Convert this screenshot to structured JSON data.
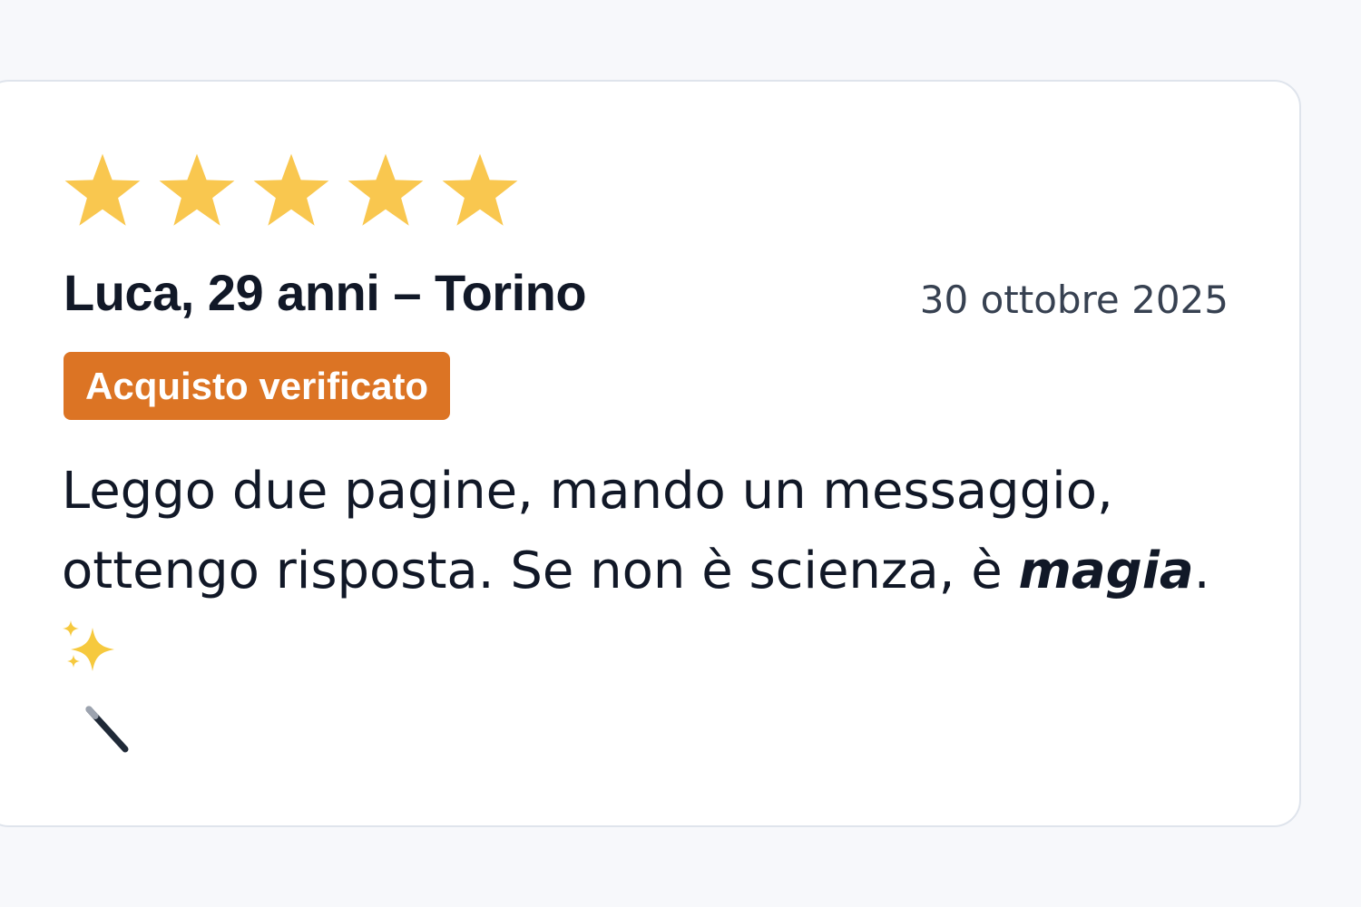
{
  "review": {
    "rating": 5,
    "rating_max": 5,
    "star_color": "#f9c74f",
    "reviewer": "Luca, 29 anni – Torino",
    "date": "30 ottobre 2025",
    "badge": {
      "label": "Acquisto verificato",
      "color": "#dc7424"
    },
    "text": {
      "line1": "Leggo due pagine, mando un messaggio,",
      "line2_prefix": "ottengo risposta. Se non è scienza, è ",
      "emphasis": "magia",
      "line2_suffix": "."
    },
    "icons": [
      "sparkles-icon",
      "magic-wand-icon"
    ]
  }
}
